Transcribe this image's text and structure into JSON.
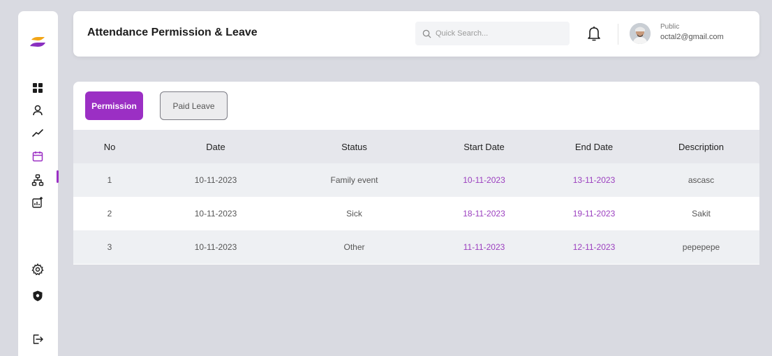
{
  "header": {
    "title": "Attendance Permission & Leave",
    "search_placeholder": "Quick Search...",
    "user_name": "Public",
    "user_email": "octal2@gmail.com"
  },
  "sidebar": {
    "items": [
      {
        "icon": "dashboard-grid-icon"
      },
      {
        "icon": "user-icon"
      },
      {
        "icon": "trend-chart-icon"
      },
      {
        "icon": "calendar-icon",
        "active": true
      },
      {
        "icon": "org-structure-icon"
      },
      {
        "icon": "report-chart-icon"
      },
      {
        "icon": "gear-icon"
      },
      {
        "icon": "shield-icon"
      },
      {
        "icon": "logout-icon"
      }
    ]
  },
  "tabs": {
    "permission": "Permission",
    "paid_leave": "Paid Leave"
  },
  "table": {
    "headers": [
      "No",
      "Date",
      "Status",
      "Start Date",
      "End Date",
      "Description"
    ],
    "rows": [
      [
        "1",
        "10-11-2023",
        "Family event",
        "10-11-2023",
        "13-11-2023",
        "ascasc"
      ],
      [
        "2",
        "10-11-2023",
        "Sick",
        "18-11-2023",
        "19-11-2023",
        "Sakit"
      ],
      [
        "3",
        "10-11-2023",
        "Other",
        "11-11-2023",
        "12-11-2023",
        "pepepepe"
      ]
    ]
  },
  "colors": {
    "accent": "#9b2fc4",
    "logo_orange": "#f2a516",
    "logo_purple": "#8a2fc0"
  }
}
